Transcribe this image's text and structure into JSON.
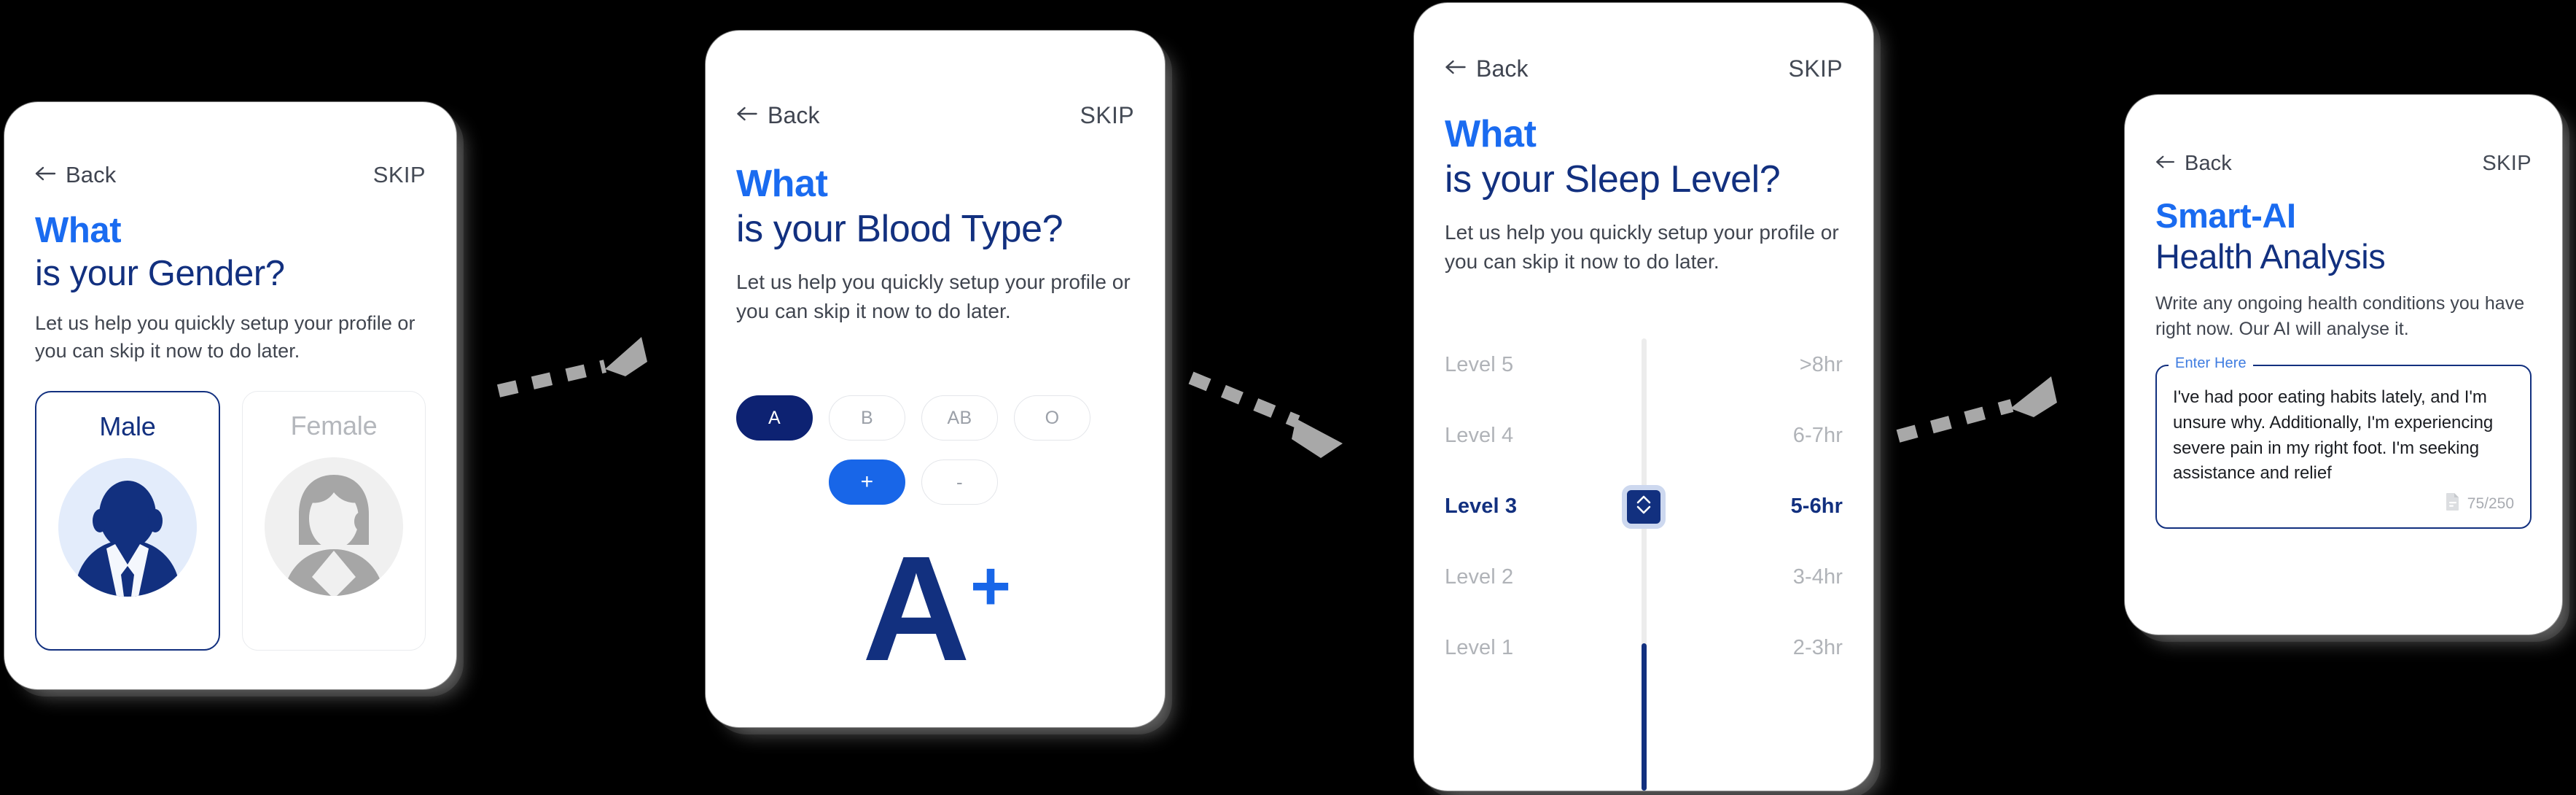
{
  "common": {
    "back_label": "Back",
    "skip_label": "SKIP",
    "subtitle": "Let us help you quickly setup your profile or you can skip it now to do later.",
    "colors": {
      "accent_blue": "#1a6bf0",
      "navy": "#12307f",
      "pill_navy": "#0d2272",
      "pill_blue": "#1866e8",
      "muted_grey": "#b0b3b8",
      "background": "#000000",
      "card": "#ffffff"
    }
  },
  "cards": [
    {
      "id": "gender",
      "back_label": "Back",
      "skip_label": "SKIP",
      "title_line1": "What",
      "title_line2": "is your Gender?",
      "subtitle": "Let us help you quickly setup your profile or you can skip it now to do later.",
      "options": [
        {
          "label": "Male",
          "selected": true,
          "icon": "male-avatar-icon"
        },
        {
          "label": "Female",
          "selected": false,
          "icon": "female-avatar-icon"
        }
      ]
    },
    {
      "id": "blood",
      "back_label": "Back",
      "skip_label": "SKIP",
      "title_line1": "What",
      "title_line2": "is your Blood Type?",
      "subtitle": "Let us help you quickly setup your profile or you can skip it now to do later.",
      "types": [
        {
          "label": "A",
          "selected": true
        },
        {
          "label": "B",
          "selected": false
        },
        {
          "label": "AB",
          "selected": false
        },
        {
          "label": "O",
          "selected": false
        }
      ],
      "signs": [
        {
          "label": "+",
          "selected": true
        },
        {
          "label": "-",
          "selected": false
        }
      ],
      "result_letter": "A",
      "result_sign": "+"
    },
    {
      "id": "sleep",
      "back_label": "Back",
      "skip_label": "SKIP",
      "title_line1": "What",
      "title_line2": "is your Sleep Level?",
      "subtitle": "Let us help you quickly setup your profile or you can skip it now to do later.",
      "levels": [
        {
          "label": "Level 5",
          "value": ">8hr",
          "selected": false
        },
        {
          "label": "Level 4",
          "value": "6-7hr",
          "selected": false
        },
        {
          "label": "Level 3",
          "value": "5-6hr",
          "selected": true
        },
        {
          "label": "Level 2",
          "value": "3-4hr",
          "selected": false
        },
        {
          "label": "Level 1",
          "value": "2-3hr",
          "selected": false
        }
      ],
      "selected_level": "Level 3"
    },
    {
      "id": "ai",
      "back_label": "Back",
      "skip_label": "SKIP",
      "title_line1": "Smart-AI",
      "title_line2": "Health Analysis",
      "subtitle": "Write any ongoing health conditions you have right now. Our AI will analyse it.",
      "field_label": "Enter Here",
      "field_value": "I've had poor eating habits lately, and I'm unsure why. Additionally, I'm experiencing severe pain in my right foot. I'm seeking assistance and relief",
      "counter": "75/250",
      "counter_icon": "document-icon"
    }
  ],
  "connectors": [
    {
      "id": "connector-1",
      "direction": "up-right",
      "style": "dashed-arrow"
    },
    {
      "id": "connector-2",
      "direction": "down-right",
      "style": "dashed-arrow"
    },
    {
      "id": "connector-3",
      "direction": "up-right",
      "style": "dashed-arrow"
    }
  ]
}
